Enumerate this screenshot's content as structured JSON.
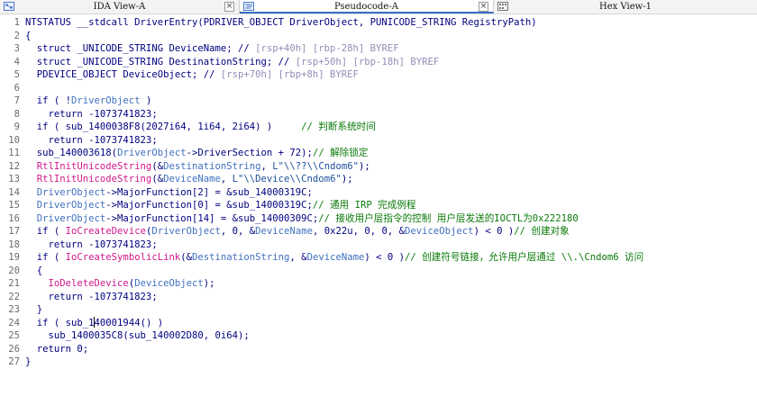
{
  "tabs": [
    {
      "label": "IDA View-A",
      "icon": "ida-view-icon",
      "active": false,
      "close": "×"
    },
    {
      "label": "Pseudocode-A",
      "icon": "pseudocode-icon",
      "active": true,
      "close": "×"
    },
    {
      "label": "Hex View-1",
      "icon": "hex-view-icon",
      "active": false,
      "close": "×"
    }
  ],
  "accent_color": "#3a6fc4",
  "code_lines": [
    {
      "n": "1",
      "t": [
        [
          "k",
          "NTSTATUS __stdcall DriverEntry(PDRIVER_OBJECT DriverObject, PUNICODE_STRING RegistryPath)"
        ]
      ]
    },
    {
      "n": "2",
      "t": [
        [
          "k",
          "{"
        ]
      ]
    },
    {
      "n": "3",
      "t": [
        [
          "k",
          "  struct _UNICODE_STRING DeviceName; // "
        ],
        [
          "r",
          "[rsp+40h] [rbp-28h] BYREF"
        ]
      ]
    },
    {
      "n": "4",
      "t": [
        [
          "k",
          "  struct _UNICODE_STRING DestinationString; // "
        ],
        [
          "r",
          "[rsp+50h] [rbp-18h] BYREF"
        ]
      ]
    },
    {
      "n": "5",
      "t": [
        [
          "k",
          "  PDEVICE_OBJECT DeviceObject; // "
        ],
        [
          "r",
          "[rsp+70h] [rbp+8h] BYREF"
        ]
      ]
    },
    {
      "n": "6",
      "t": []
    },
    {
      "n": "7",
      "t": [
        [
          "k",
          "  if ( !"
        ],
        [
          "v",
          "DriverObject"
        ],
        [
          "k",
          " )"
        ]
      ]
    },
    {
      "n": "8",
      "t": [
        [
          "k",
          "    return -1073741823;"
        ]
      ]
    },
    {
      "n": "9",
      "t": [
        [
          "k",
          "  if ( sub_1400038F8(2027i64, 1i64, 2i64) )     "
        ],
        [
          "c",
          "// 判断系统时间"
        ]
      ]
    },
    {
      "n": "10",
      "t": [
        [
          "k",
          "    return -1073741823;"
        ]
      ]
    },
    {
      "n": "11",
      "t": [
        [
          "k",
          "  sub_140003618("
        ],
        [
          "v",
          "DriverObject"
        ],
        [
          "k",
          "->DriverSection + 72);"
        ],
        [
          "c",
          "// 解除锁定"
        ]
      ]
    },
    {
      "n": "12",
      "t": [
        [
          "f",
          "  RtlInitUnicodeString"
        ],
        [
          "k",
          "(&"
        ],
        [
          "v",
          "DestinationString"
        ],
        [
          "k",
          ", "
        ],
        [
          "s",
          "L\"\\\\??\\\\Cndom6\""
        ],
        [
          "k",
          ");"
        ]
      ]
    },
    {
      "n": "13",
      "t": [
        [
          "f",
          "  RtlInitUnicodeString"
        ],
        [
          "k",
          "(&"
        ],
        [
          "v",
          "DeviceName"
        ],
        [
          "k",
          ", "
        ],
        [
          "s",
          "L\"\\\\Device\\\\Cndom6\""
        ],
        [
          "k",
          ");"
        ]
      ]
    },
    {
      "n": "14",
      "t": [
        [
          "v",
          "  DriverObject"
        ],
        [
          "k",
          "->MajorFunction[2] = &sub_14000319C;"
        ]
      ]
    },
    {
      "n": "15",
      "t": [
        [
          "v",
          "  DriverObject"
        ],
        [
          "k",
          "->MajorFunction[0] = &sub_14000319C;"
        ],
        [
          "c",
          "// 通用 IRP 完成例程"
        ]
      ]
    },
    {
      "n": "16",
      "t": [
        [
          "v",
          "  DriverObject"
        ],
        [
          "k",
          "->MajorFunction[14] = &sub_14000309C;"
        ],
        [
          "c",
          "// 接收用户层指令的控制 用户层发送的IOCTL为0x222180"
        ]
      ]
    },
    {
      "n": "17",
      "t": [
        [
          "k",
          "  if ( "
        ],
        [
          "f",
          "IoCreateDevice"
        ],
        [
          "k",
          "("
        ],
        [
          "v",
          "DriverObject"
        ],
        [
          "k",
          ", 0, &"
        ],
        [
          "v",
          "DeviceName"
        ],
        [
          "k",
          ", 0x22u, 0, 0, &"
        ],
        [
          "v",
          "DeviceObject"
        ],
        [
          "k",
          ") < 0 )"
        ],
        [
          "c",
          "// 创建对象"
        ]
      ]
    },
    {
      "n": "18",
      "t": [
        [
          "k",
          "    return -1073741823;"
        ]
      ]
    },
    {
      "n": "19",
      "t": [
        [
          "k",
          "  if ( "
        ],
        [
          "f",
          "IoCreateSymbolicLink"
        ],
        [
          "k",
          "(&"
        ],
        [
          "v",
          "DestinationString"
        ],
        [
          "k",
          ", &"
        ],
        [
          "v",
          "DeviceName"
        ],
        [
          "k",
          ") < 0 )"
        ],
        [
          "c",
          "// 创建符号链接，允许用户层通过 \\\\.\\Cndom6 访问"
        ]
      ]
    },
    {
      "n": "20",
      "t": [
        [
          "k",
          "  {"
        ]
      ]
    },
    {
      "n": "21",
      "t": [
        [
          "f",
          "    IoDeleteDevice"
        ],
        [
          "k",
          "("
        ],
        [
          "v",
          "DeviceObject"
        ],
        [
          "k",
          ");"
        ]
      ]
    },
    {
      "n": "22",
      "t": [
        [
          "k",
          "    return -1073741823;"
        ]
      ]
    },
    {
      "n": "23",
      "t": [
        [
          "k",
          "  }"
        ]
      ]
    },
    {
      "n": "24",
      "t": [
        [
          "k",
          "  if ( sub_1"
        ],
        [
          "cursor",
          ""
        ],
        [
          "k",
          "40001944() )"
        ]
      ]
    },
    {
      "n": "25",
      "t": [
        [
          "k",
          "    sub_1400035C8(sub_140002D80, 0i64);"
        ]
      ]
    },
    {
      "n": "26",
      "t": [
        [
          "k",
          "  return 0;"
        ]
      ]
    },
    {
      "n": "27",
      "t": [
        [
          "k",
          "}"
        ]
      ]
    }
  ]
}
